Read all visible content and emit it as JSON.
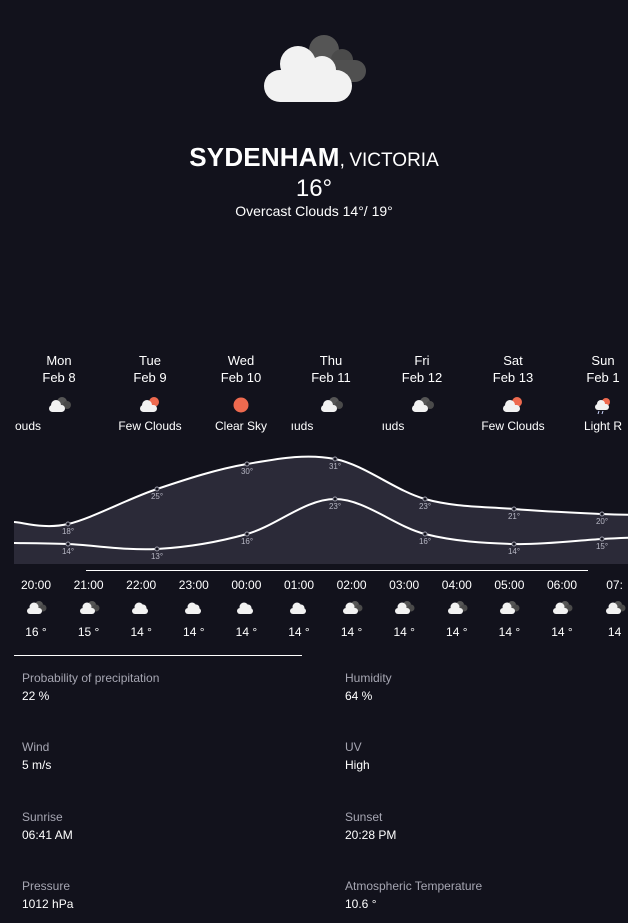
{
  "location": {
    "city": "SYDENHAM",
    "separator": ",",
    "region": "VICTORIA",
    "current_temp": "16°",
    "condition_line": "Overcast Clouds 14°/ 19°",
    "icon": "overcast-clouds-icon"
  },
  "daily": [
    {
      "weekday": "Mon",
      "date": "Feb 8",
      "label": "ouds",
      "icon": "broken-clouds-icon"
    },
    {
      "weekday": "Tue",
      "date": "Feb 9",
      "label": "Few Clouds",
      "icon": "few-clouds-icon"
    },
    {
      "weekday": "Wed",
      "date": "Feb 10",
      "label": "Clear Sky",
      "icon": "clear-sky-icon"
    },
    {
      "weekday": "Thu",
      "date": "Feb 11",
      "label": "ıuds",
      "icon": "broken-clouds-icon"
    },
    {
      "weekday": "Fri",
      "date": "Feb 12",
      "label": "ıuds",
      "icon": "broken-clouds-icon"
    },
    {
      "weekday": "Sat",
      "date": "Feb 13",
      "label": "Few Clouds",
      "icon": "few-clouds-icon"
    },
    {
      "weekday": "Sun",
      "date": "Feb 1",
      "label": "Light R",
      "icon": "light-rain-icon"
    }
  ],
  "chart_data": {
    "type": "area",
    "categories": [
      "Mon",
      "Tue",
      "Wed",
      "Thu",
      "Fri",
      "Sat",
      "Sun"
    ],
    "series": [
      {
        "values": [
          18,
          25,
          30,
          31,
          23,
          21,
          20
        ]
      },
      {
        "values": [
          14,
          13,
          16,
          23,
          16,
          14,
          15
        ]
      }
    ],
    "value_labels": [
      [
        "18°",
        "25°",
        "30°",
        "31°",
        "23°",
        "21°",
        "20°"
      ],
      [
        "14°",
        "13°",
        "16°",
        "23°",
        "16°",
        "14°",
        "15°"
      ]
    ],
    "ylim": [
      12,
      32
    ],
    "grid": false,
    "colors": {
      "line": "#ffffff",
      "fill": "#2b2a38",
      "point": "#9a9aa8"
    }
  },
  "hourly": [
    {
      "time": "20:00",
      "temp": "16 °",
      "icon": "broken-clouds-icon"
    },
    {
      "time": "21:00",
      "temp": "15 °",
      "icon": "broken-clouds-icon"
    },
    {
      "time": "22:00",
      "temp": "14 °",
      "icon": "cloud-icon"
    },
    {
      "time": "23:00",
      "temp": "14 °",
      "icon": "cloud-icon"
    },
    {
      "time": "00:00",
      "temp": "14 °",
      "icon": "cloud-icon"
    },
    {
      "time": "01:00",
      "temp": "14 °",
      "icon": "cloud-icon"
    },
    {
      "time": "02:00",
      "temp": "14 °",
      "icon": "broken-clouds-icon"
    },
    {
      "time": "03:00",
      "temp": "14 °",
      "icon": "broken-clouds-icon"
    },
    {
      "time": "04:00",
      "temp": "14 °",
      "icon": "broken-clouds-icon"
    },
    {
      "time": "05:00",
      "temp": "14 °",
      "icon": "broken-clouds-icon"
    },
    {
      "time": "06:00",
      "temp": "14 °",
      "icon": "broken-clouds-icon"
    },
    {
      "time": "07:",
      "temp": "14",
      "icon": "broken-clouds-icon"
    }
  ],
  "details": [
    {
      "label": "Probability of precipitation",
      "value": "22 %"
    },
    {
      "label": "Humidity",
      "value": "64 %"
    },
    {
      "label": "Wind",
      "value": "5 m/s"
    },
    {
      "label": "UV",
      "value": "High"
    },
    {
      "label": "Sunrise",
      "value": "06:41 AM"
    },
    {
      "label": "Sunset",
      "value": "20:28 PM"
    },
    {
      "label": "Pressure",
      "value": "1012 hPa"
    },
    {
      "label": "Atmospheric Temperature",
      "value": "10.6 °"
    }
  ],
  "colors": {
    "background": "#12121c",
    "sun": "#ee6a4f",
    "cloud_front": "#f2f2f2",
    "cloud_back": "#565656",
    "muted_text": "#a6a6b2"
  }
}
